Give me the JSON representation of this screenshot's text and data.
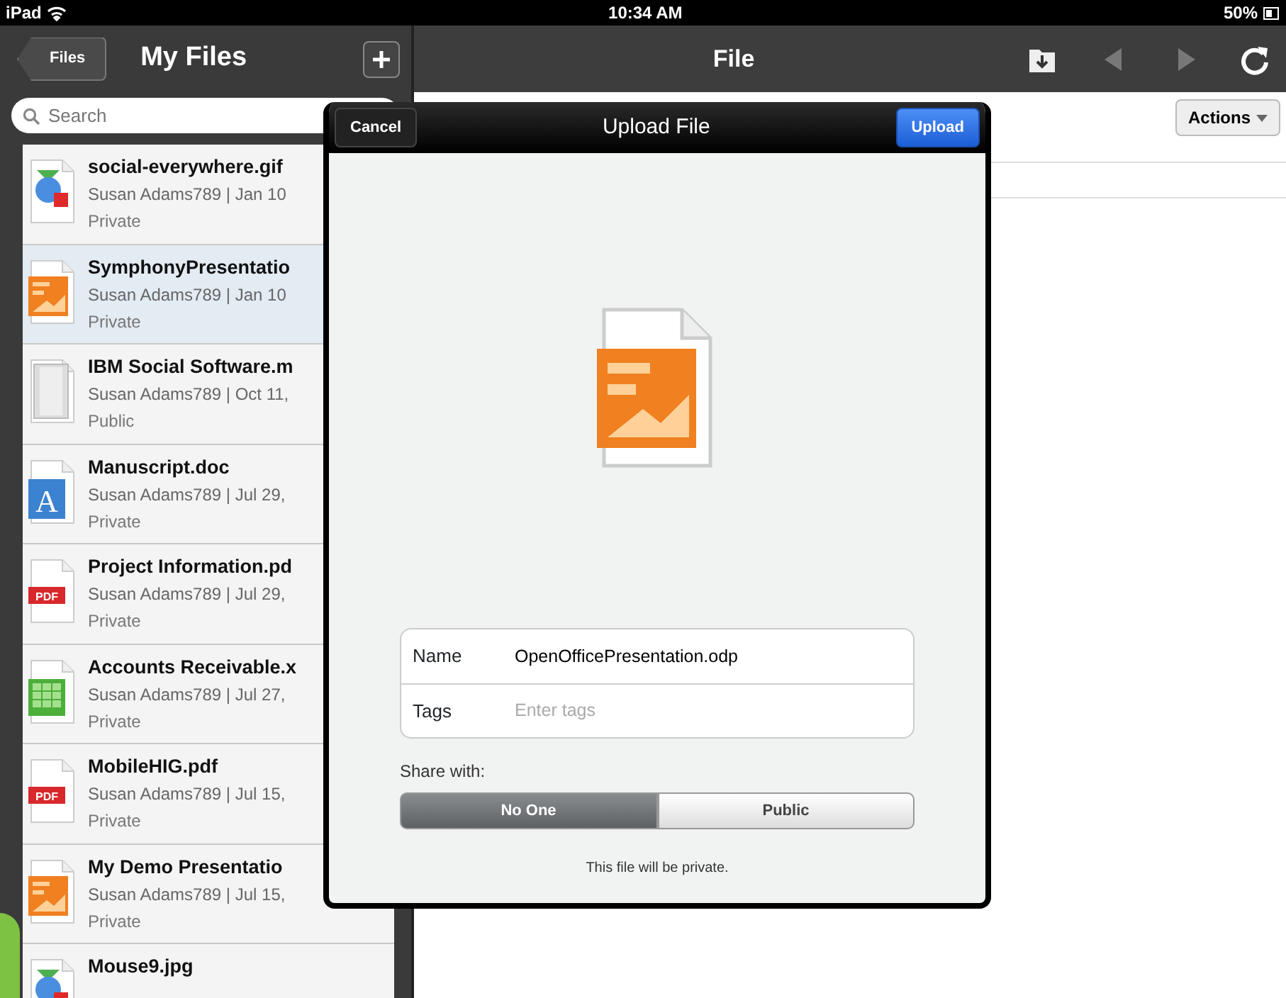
{
  "status_bar": {
    "device": "iPad",
    "time": "10:34 AM",
    "battery": "50%"
  },
  "sidebar": {
    "back_button": "Files",
    "title": "My Files",
    "search": {
      "placeholder": "Search"
    },
    "files": [
      {
        "kind": "image",
        "name": "social-everywhere.gif",
        "meta": "Susan Adams789 | Jan 10",
        "visibility": "Private",
        "selected": false
      },
      {
        "kind": "presentation",
        "name": "SymphonyPresentatio",
        "meta": "Susan Adams789 | Jan 10",
        "visibility": "Private",
        "selected": true
      },
      {
        "kind": "video",
        "name": "IBM Social Software.m",
        "meta": "Susan Adams789 | Oct 11,",
        "visibility": "Public",
        "selected": false
      },
      {
        "kind": "document",
        "icon_text": "A",
        "name": "Manuscript.doc",
        "meta": "Susan Adams789 | Jul 29,",
        "visibility": "Private",
        "selected": false
      },
      {
        "kind": "pdf",
        "icon_text": "PDF",
        "name": "Project Information.pd",
        "meta": "Susan Adams789 | Jul 29,",
        "visibility": "Private",
        "selected": false
      },
      {
        "kind": "spreadsheet",
        "name": "Accounts Receivable.x",
        "meta": "Susan Adams789 | Jul 27,",
        "visibility": "Private",
        "selected": false
      },
      {
        "kind": "pdf",
        "icon_text": "PDF",
        "name": "MobileHIG.pdf",
        "meta": "Susan Adams789 | Jul 15,",
        "visibility": "Private",
        "selected": false
      },
      {
        "kind": "presentation",
        "name": "My Demo Presentatio",
        "meta": "Susan Adams789 | Jul 15,",
        "visibility": "Private",
        "selected": false
      },
      {
        "kind": "image",
        "name": "Mouse9.jpg",
        "selected": false
      }
    ]
  },
  "main": {
    "title": "File",
    "nav": [
      {
        "kind": "folder",
        "disabled": false
      },
      {
        "kind": "back",
        "disabled": true
      },
      {
        "kind": "forward",
        "disabled": true
      },
      {
        "kind": "refresh",
        "disabled": false
      }
    ],
    "actions_button": "Actions"
  },
  "dialog": {
    "title": "Upload File",
    "cancel_button": "Cancel",
    "upload_button": "Upload",
    "preview": {
      "kind": "presentation"
    },
    "fields": [
      {
        "label": "Name",
        "value": "OpenOfficePresentation.odp"
      },
      {
        "label": "Tags",
        "placeholder": "Enter tags"
      }
    ],
    "share_label": "Share with:",
    "share_options": [
      {
        "label": "No One",
        "selected": true
      },
      {
        "label": "Public",
        "selected": false
      }
    ],
    "note": "This file will be private."
  }
}
